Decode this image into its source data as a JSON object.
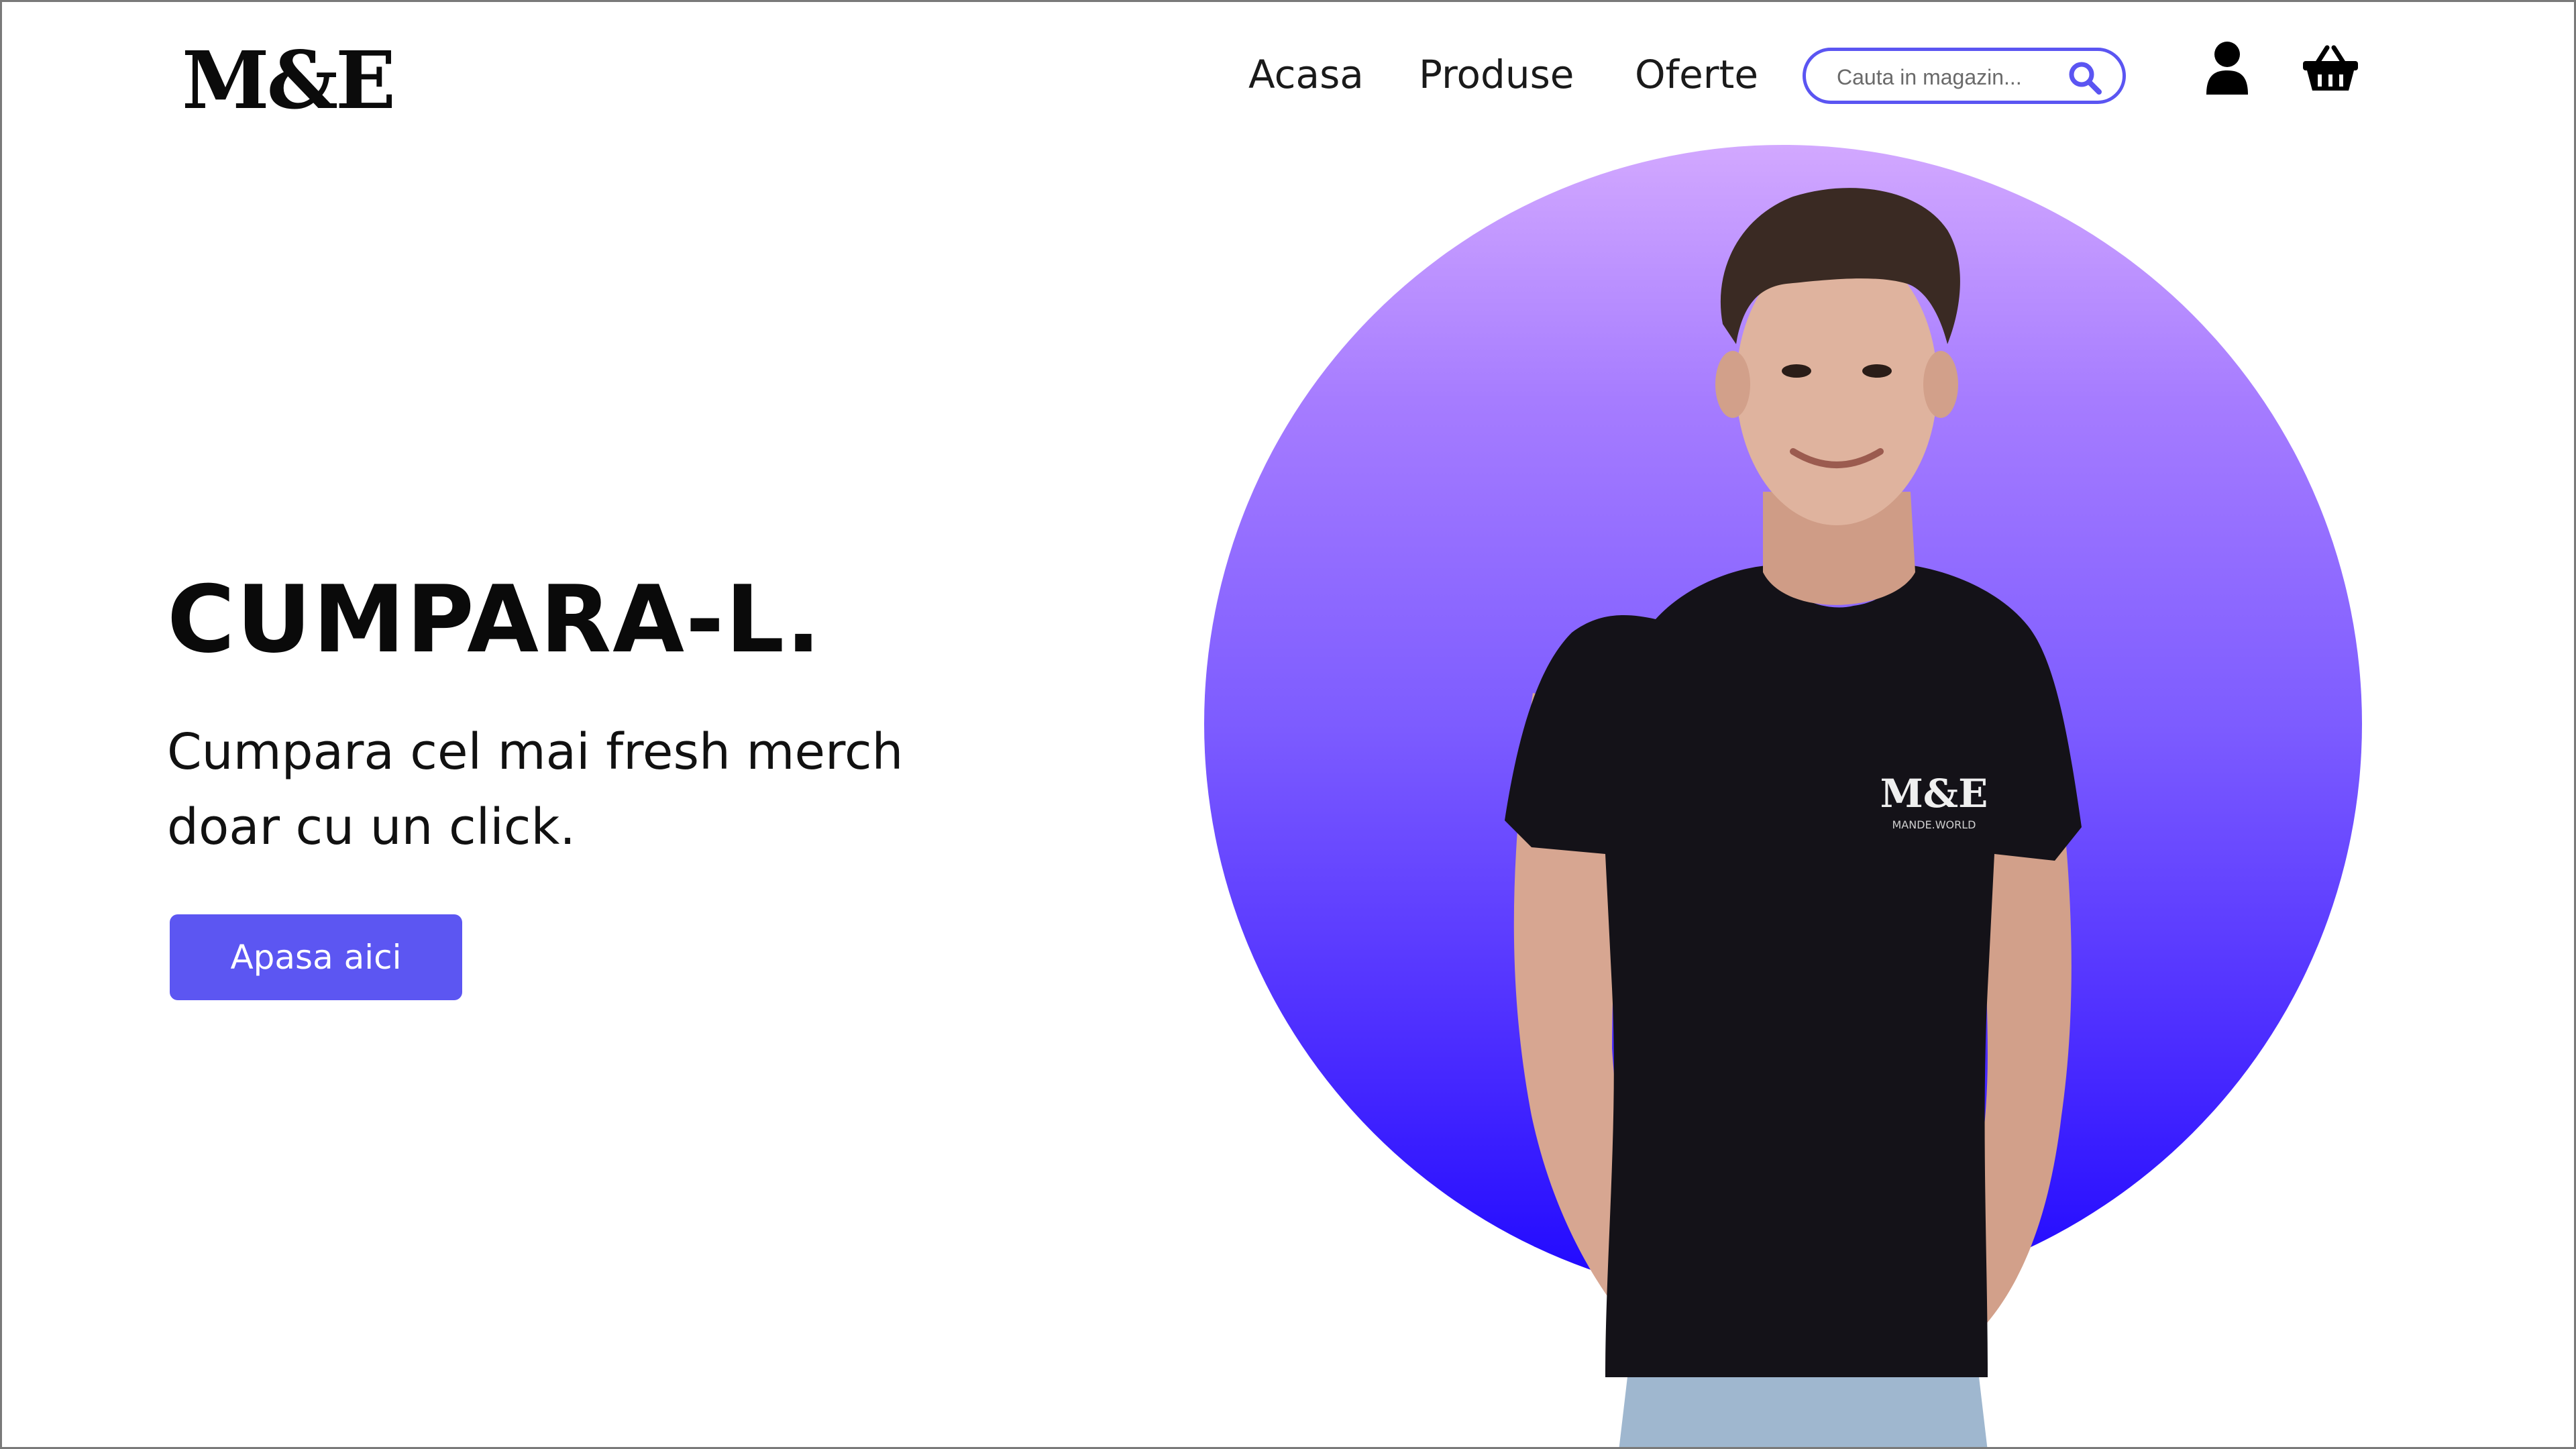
{
  "brand": {
    "logo_text": "M&E"
  },
  "nav": {
    "items": [
      "Acasa",
      "Produse",
      "Oferte"
    ]
  },
  "search": {
    "placeholder": "Cauta in magazin..."
  },
  "header_icons": [
    "user-icon",
    "basket-icon"
  ],
  "hero": {
    "title": "CUMPARA-L.",
    "subtitle_line1": "Cumpara cel mai fresh merch",
    "subtitle_line2": "doar cu un click.",
    "cta_label": "Apasa aici"
  },
  "shirt": {
    "logo": "M&E",
    "tagline": "MANDE.WORLD"
  },
  "colors": {
    "accent": "#5c56f2",
    "circle_top": "#d2a8ff",
    "circle_bottom": "#1d06ff",
    "text": "#0a0a0a"
  }
}
